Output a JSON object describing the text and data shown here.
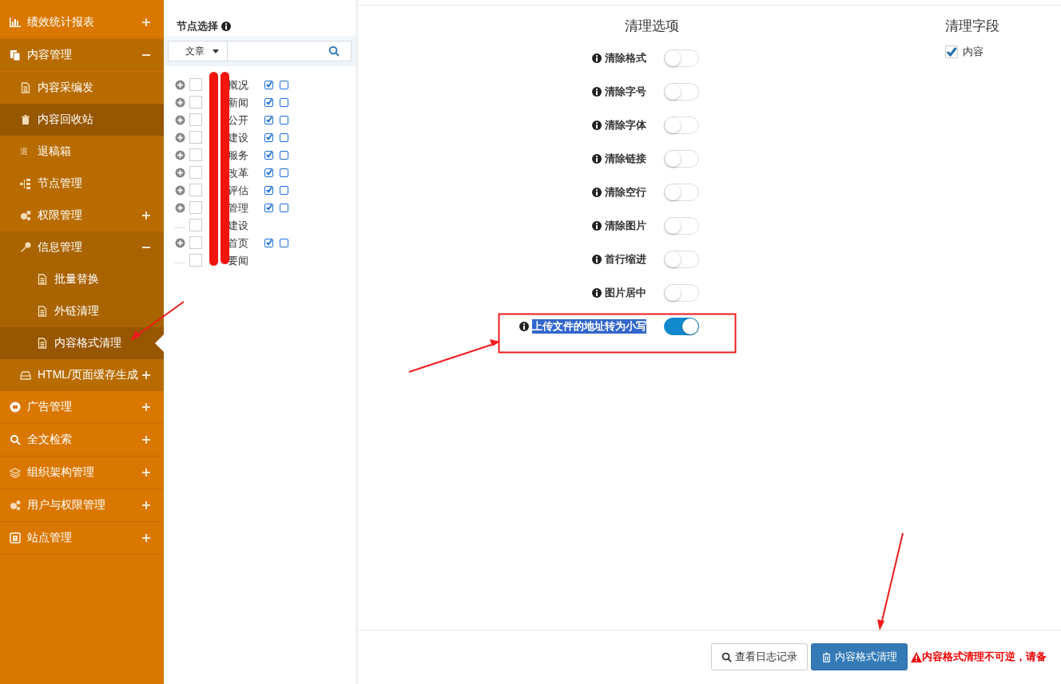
{
  "sidebar": {
    "items": [
      {
        "label": "绩效统计报表",
        "selected": false,
        "expanded": false
      },
      {
        "label": "内容管理",
        "selected": false,
        "expanded": true,
        "children": [
          {
            "label": "内容采编发",
            "selected": false
          },
          {
            "label": "内容回收站",
            "selected": false,
            "hovered": true
          },
          {
            "label": "退稿箱",
            "selected": false,
            "badge": "退"
          },
          {
            "label": "节点管理",
            "selected": false
          },
          {
            "label": "权限管理",
            "selected": false,
            "expanded": false
          },
          {
            "label": "信息管理",
            "selected": false,
            "expanded": true,
            "children": [
              {
                "label": "批量替换",
                "selected": false
              },
              {
                "label": "外链清理",
                "selected": false
              },
              {
                "label": "内容格式清理",
                "selected": true
              }
            ]
          },
          {
            "label": "HTML/页面缓存生成",
            "selected": false,
            "expanded": false
          }
        ]
      },
      {
        "label": "广告管理",
        "selected": false,
        "expanded": false
      },
      {
        "label": "全文检索",
        "selected": false,
        "expanded": false
      },
      {
        "label": "组织架构管理",
        "selected": false,
        "expanded": false
      },
      {
        "label": "用户与权限管理",
        "selected": false,
        "expanded": false
      },
      {
        "label": "站点管理",
        "selected": false,
        "expanded": false
      }
    ]
  },
  "node_panel": {
    "title": "节点选择",
    "type_select": "文章",
    "tree": [
      {
        "label": "概况",
        "expandable": true,
        "checked": false,
        "flags": [
          {
            "checked": true
          },
          {
            "checked": false
          }
        ]
      },
      {
        "label": "新闻",
        "expandable": true,
        "checked": false,
        "flags": [
          {
            "checked": true
          },
          {
            "checked": false
          }
        ]
      },
      {
        "label": "公开",
        "expandable": true,
        "checked": false,
        "flags": [
          {
            "checked": true
          },
          {
            "checked": false
          }
        ]
      },
      {
        "label": "建设",
        "expandable": true,
        "checked": false,
        "flags": [
          {
            "checked": true
          },
          {
            "checked": false
          }
        ]
      },
      {
        "label": "服务",
        "expandable": true,
        "checked": false,
        "flags": [
          {
            "checked": true
          },
          {
            "checked": false
          }
        ]
      },
      {
        "label": "改革",
        "expandable": true,
        "checked": false,
        "flags": [
          {
            "checked": true
          },
          {
            "checked": false
          }
        ]
      },
      {
        "label": "评估",
        "expandable": true,
        "checked": false,
        "flags": [
          {
            "checked": true
          },
          {
            "checked": false
          }
        ]
      },
      {
        "label": "管理",
        "expandable": true,
        "checked": false,
        "flags": [
          {
            "checked": true
          },
          {
            "checked": false
          }
        ]
      },
      {
        "label": "建设",
        "expandable": false,
        "checked": false
      },
      {
        "label": "首页",
        "expandable": true,
        "checked": false,
        "flags": [
          {
            "checked": true
          },
          {
            "checked": false
          }
        ]
      },
      {
        "label": "要闻",
        "expandable": false,
        "checked": false
      }
    ]
  },
  "options": {
    "title": "清理选项",
    "items": [
      {
        "label": "清除格式",
        "on": false,
        "highlighted": false
      },
      {
        "label": "清除字号",
        "on": false,
        "highlighted": false
      },
      {
        "label": "清除字体",
        "on": false,
        "highlighted": false
      },
      {
        "label": "清除链接",
        "on": false,
        "highlighted": false
      },
      {
        "label": "清除空行",
        "on": false,
        "highlighted": false
      },
      {
        "label": "清除图片",
        "on": false,
        "highlighted": false
      },
      {
        "label": "首行缩进",
        "on": false,
        "highlighted": false
      },
      {
        "label": "图片居中",
        "on": false,
        "highlighted": false
      },
      {
        "label": "上传文件的地址转为小写",
        "on": true,
        "highlighted": true
      }
    ]
  },
  "fields": {
    "title": "清理字段",
    "items": [
      {
        "label": "内容",
        "checked": true
      }
    ]
  },
  "footer": {
    "buttons": [
      {
        "label": "查看日志记录",
        "kind": "log"
      },
      {
        "label": "内容格式清理",
        "kind": "clean"
      }
    ],
    "warning": "内容格式清理不可逆，请备"
  }
}
